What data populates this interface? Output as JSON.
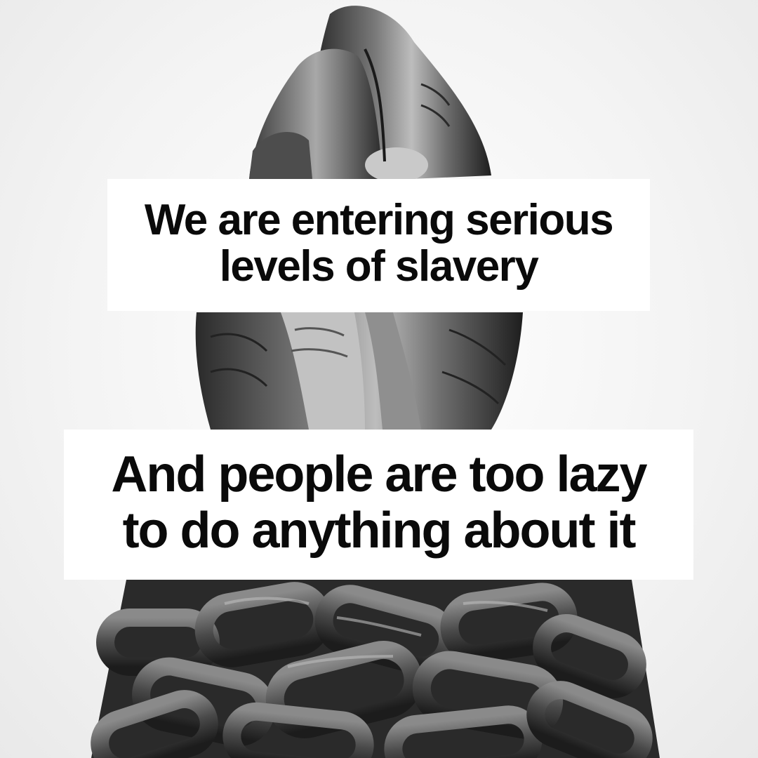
{
  "headline": {
    "line1": "We are entering serious",
    "line2": "levels of slavery"
  },
  "subline": {
    "line1": "And people are too lazy",
    "line2": "to do anything about it"
  },
  "colors": {
    "caption_bg": "#ffffff",
    "caption_text": "#0a0a0a",
    "background": "#f4f4f4"
  }
}
